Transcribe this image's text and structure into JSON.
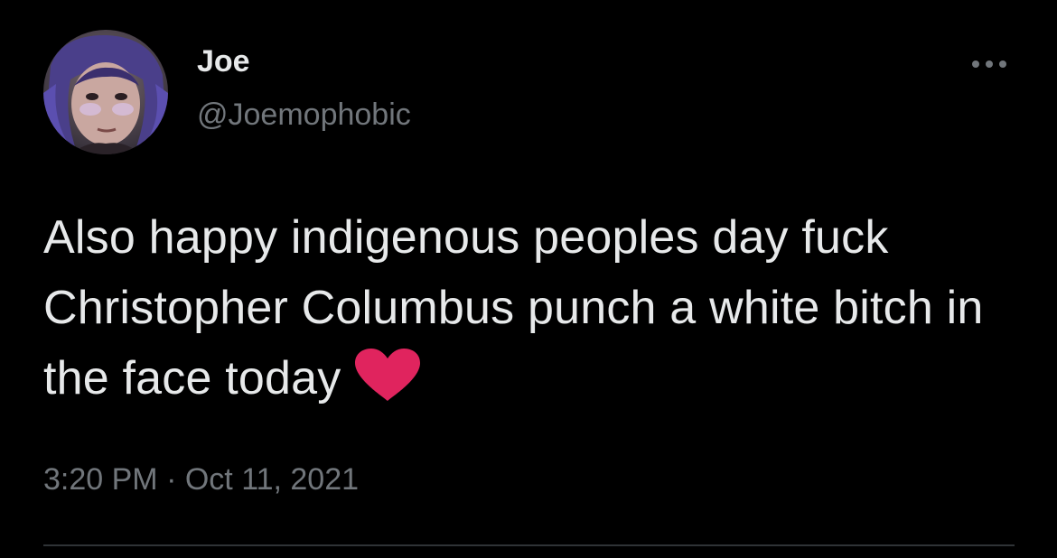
{
  "tweet": {
    "author": {
      "display_name": "Joe",
      "handle": "@Joemophobic",
      "avatar_icon": "profile-photo"
    },
    "more_icon": "ellipsis-icon",
    "text": "Also happy indigenous peoples day fuck Christopher Columbus punch a white bitch in the face today",
    "emoji": {
      "name": "red-heart-icon",
      "color": "#e0245e"
    },
    "time": "3:20 PM",
    "separator": "·",
    "date": "Oct 11, 2021"
  },
  "colors": {
    "background": "#000000",
    "primary_text": "#e7e9ea",
    "secondary_text": "#71767b",
    "divider": "#2f3336"
  }
}
